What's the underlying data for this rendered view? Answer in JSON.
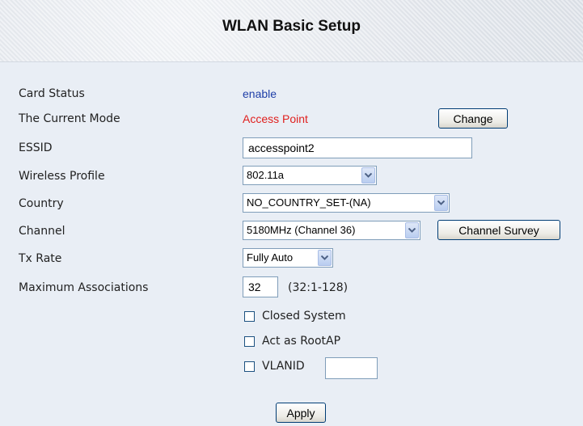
{
  "page": {
    "title": "WLAN Basic Setup"
  },
  "fields": {
    "card_status": {
      "label": "Card Status",
      "value": "enable",
      "color": "#1f3fa8"
    },
    "current_mode": {
      "label": "The Current Mode",
      "value": "Access Point",
      "color": "#e0201e",
      "button": "Change"
    },
    "essid": {
      "label": "ESSID",
      "value": "accesspoint2"
    },
    "wireless_profile": {
      "label": "Wireless Profile",
      "value": "802.11a"
    },
    "country": {
      "label": "Country",
      "value": "NO_COUNTRY_SET-(NA)"
    },
    "channel": {
      "label": "Channel",
      "value": "5180MHz (Channel 36)",
      "button": "Channel Survey"
    },
    "tx_rate": {
      "label": "Tx Rate",
      "value": "Fully Auto"
    },
    "max_assoc": {
      "label": "Maximum Associations",
      "value": "32",
      "hint": "(32:1-128)"
    }
  },
  "options": {
    "closed_system": "Closed System",
    "act_as_rootap": "Act as RootAP",
    "vlanid": "VLANID",
    "vlanid_value": ""
  },
  "actions": {
    "apply": "Apply"
  },
  "icons": {
    "dropdown_arrow": "chevron-down-icon"
  }
}
